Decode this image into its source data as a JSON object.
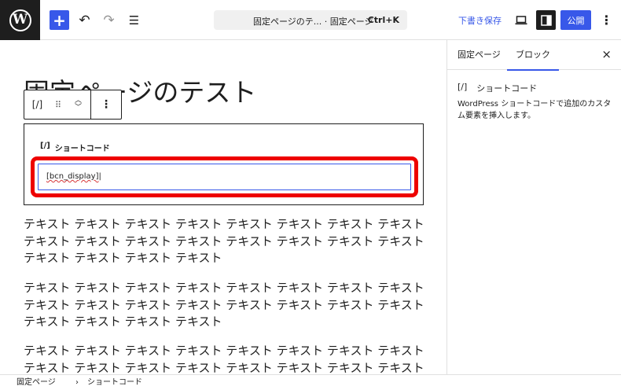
{
  "header": {
    "logo_glyph": "W",
    "add_glyph": "+",
    "undo_glyph": "↶",
    "redo_glyph": "↷",
    "list_view_glyph": "☰",
    "doc_title": "固定ページのテ... · 固定ページ",
    "doc_shortcut": "Ctrl+K",
    "save_draft_label": "下書き保存",
    "publish_label": "公開",
    "more_glyph": "⋮",
    "accent_color": "#3858e9"
  },
  "sidebar": {
    "tabs": [
      "固定ページ",
      "ブロック"
    ],
    "active_tab": "ブロック",
    "close_glyph": "×",
    "block_icon": "[/]",
    "block_name": "ショートコード",
    "block_description": "WordPress ショートコードで追加のカスタム要素を挿入します。"
  },
  "editor": {
    "page_title": "固定ページのテスト",
    "block_toolbar": {
      "block_icon": "[/]",
      "drag_glyph": "⠿",
      "move_up_glyph": "︿",
      "move_down_glyph": "﹀",
      "options_glyph": "⋮"
    },
    "shortcode_block": {
      "icon": "[/]",
      "label": "ショートコード",
      "value": "[bcn_display]",
      "highlight_color": "#ee0000"
    },
    "paragraphs": [
      "テキスト テキスト テキスト テキスト テキスト テキスト テキスト テキスト テキスト テキスト テキスト テキスト テキスト テキスト テキスト テキスト テキスト テキスト テキスト テキスト",
      "テキスト テキスト テキスト テキスト テキスト テキスト テキスト テキスト テキスト テキスト テキスト テキスト テキスト テキスト テキスト テキスト テキスト テキスト テキスト テキスト",
      "テキスト テキスト テキスト テキスト テキスト テキスト テキスト テキスト テキスト テキスト テキスト テキスト テキスト テキスト テキスト テキスト"
    ]
  },
  "footer": {
    "breadcrumbs": [
      "固定ページ",
      "ショートコード"
    ],
    "separator": "›"
  }
}
